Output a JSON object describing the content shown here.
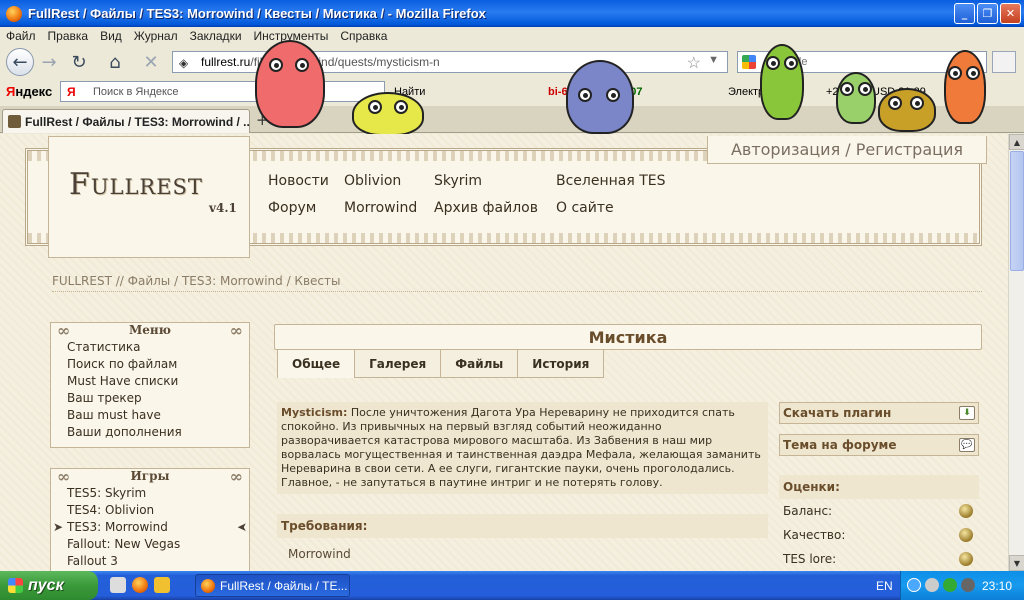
{
  "window": {
    "title": "FullRest / Файлы / TES3: Morrowind / Квесты / Мистика / - Mozilla Firefox",
    "min": "_",
    "max": "❐",
    "close": "✕"
  },
  "menu": [
    "Файл",
    "Правка",
    "Вид",
    "Журнал",
    "Закладки",
    "Инструменты",
    "Справка"
  ],
  "nav": {
    "url_host": "fullrest.ru",
    "url_path": "/files/morrowind/quests/mysticism-n",
    "search_placeholder": "Google"
  },
  "yandex": {
    "logo_first": "Я",
    "logo_rest": "ндекс",
    "search_placeholder": "Поиск в Яндексе",
    "find_label": "Найти",
    "item_bi": "bi-6663",
    "item_mail": "4007",
    "item_city": "Электрогорск",
    "item_temp": "+2°",
    "item_usd": "USD 31,39"
  },
  "tabs": {
    "active_tab": "FullRest / Файлы / TES3: Morrowind / ...",
    "new_tab": "+"
  },
  "header": {
    "logo": "Fullrest",
    "version": "v4.1",
    "auth": "Авторизация / Регистрация",
    "nav": {
      "news": "Новости",
      "oblivion": "Oblivion",
      "skyrim": "Skyrim",
      "universe": "Вселенная TES",
      "forum": "Форум",
      "morrowind": "Morrowind",
      "archive": "Архив файлов",
      "about": "О сайте"
    }
  },
  "breadcrumb": "FULLREST // Файлы / TES3: Morrowind / Квесты",
  "menu_box": {
    "title": "Меню",
    "items": [
      "Статистика",
      "Поиск по файлам",
      "Must Have списки",
      "Ваш трекер",
      "Ваш must have",
      "Ваши дополнения"
    ]
  },
  "games_box": {
    "title": "Игры",
    "items": [
      "TES5: Skyrim",
      "TES4: Oblivion",
      "TES3: Morrowind",
      "Fallout: New Vegas",
      "Fallout 3"
    ]
  },
  "content": {
    "title": "Мистика",
    "tabs": [
      "Общее",
      "Галерея",
      "Файлы",
      "История"
    ],
    "desc_lead": "Mysticism:",
    "desc_text": "После уничтожения Дагота Ура Нереварину не приходится спать спокойно. Из привычных на первый взгляд событий неожиданно разворачивается катастрова мирового масштаба. Из Забвения в наш мир ворвалась могущественная и таинственная даэдра Мефала, желающая заманить Нереварина в свои сети. А ее слуги, гигантские пауки, очень проголодались. Главное, - не запутаться в паутине интриг и не потерять голову.",
    "req_title": "Требования:",
    "req_item": "Morrowind"
  },
  "side": {
    "download": "Скачать плагин",
    "forum_topic": "Тема на форуме",
    "ratings_title": "Оценки:",
    "ratings": [
      "Баланс:",
      "Качество:",
      "TES lore:"
    ]
  },
  "taskbar": {
    "start": "пуск",
    "task": "FullRest / Файлы / TE...",
    "lang": "EN",
    "clock": "23:10"
  },
  "colors": {
    "titlebar": "#0a5fe0",
    "accent": "#6a4e2c",
    "taskbar": "#245edb"
  }
}
